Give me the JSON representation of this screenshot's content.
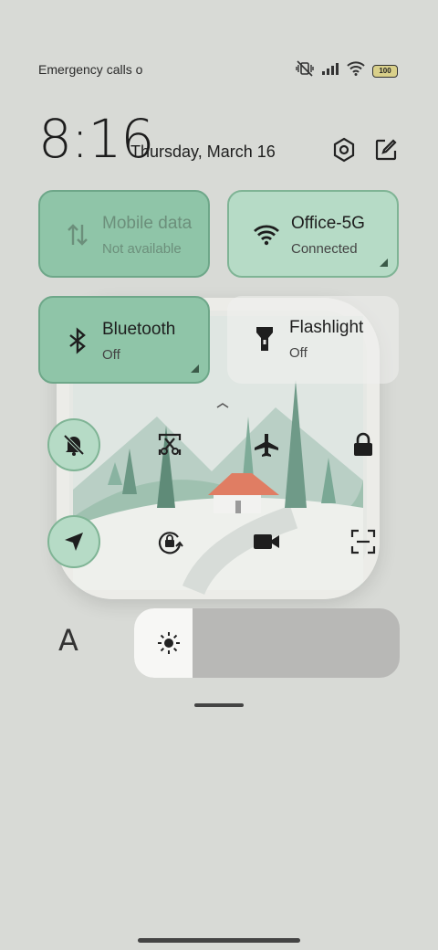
{
  "status_bar": {
    "carrier": "Emergency calls o",
    "battery": "100",
    "icons": [
      "mute-vibrate-icon",
      "signal-icon",
      "wifi-icon",
      "battery-icon"
    ]
  },
  "header": {
    "time": "8:16",
    "date": "Thursday, March 16",
    "settings_icon": "settings-icon",
    "edit_icon": "edit-icon"
  },
  "tiles": [
    {
      "title": "Mobile data",
      "subtitle": "Not available",
      "icon": "mobile-data-icon",
      "state": "unavailable"
    },
    {
      "title": "Office-5G",
      "subtitle": "Connected",
      "icon": "wifi-icon",
      "state": "on"
    },
    {
      "title": "Bluetooth",
      "subtitle": "Off",
      "icon": "bluetooth-icon",
      "state": "on"
    },
    {
      "title": "Flashlight",
      "subtitle": "Off",
      "icon": "flashlight-icon",
      "state": "off"
    }
  ],
  "quick_toggles": [
    {
      "icon": "silent-bell-icon",
      "active": true
    },
    {
      "icon": "screenshot-icon",
      "active": false
    },
    {
      "icon": "airplane-icon",
      "active": false
    },
    {
      "icon": "lock-icon",
      "active": false
    },
    {
      "icon": "location-icon",
      "active": true
    },
    {
      "icon": "rotation-lock-icon",
      "active": false
    },
    {
      "icon": "screen-record-icon",
      "active": false
    },
    {
      "icon": "scan-icon",
      "active": false
    }
  ],
  "brightness": {
    "font_label": "A",
    "level": 0.22
  },
  "colors": {
    "accent": "#b6dbc6",
    "accent_border": "#7fb495",
    "background": "#d8dad6"
  }
}
